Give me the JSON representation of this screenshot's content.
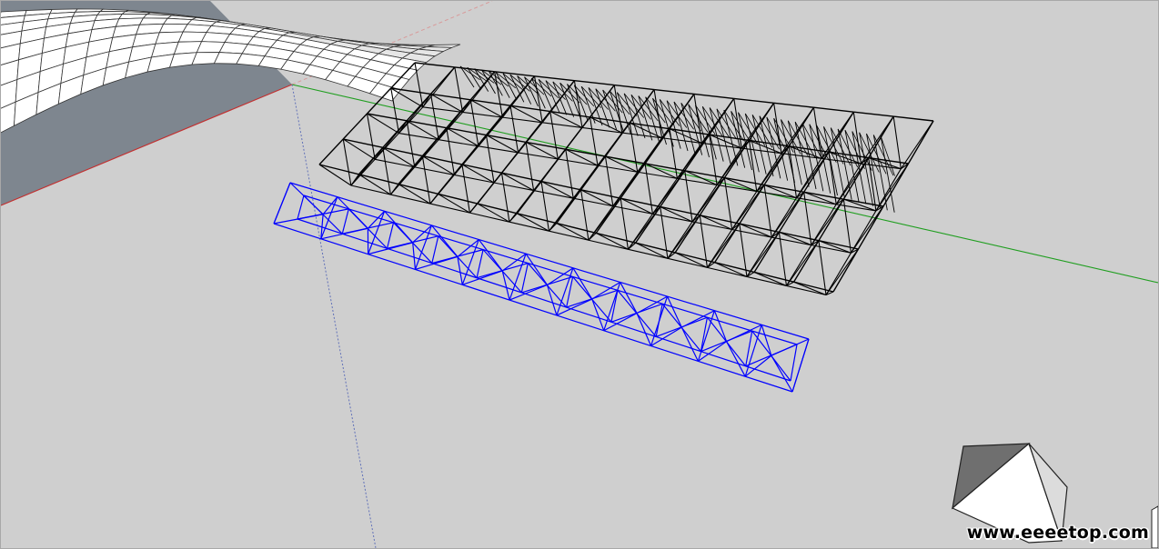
{
  "viewport": {
    "background_color": "#cfcfcf",
    "axis_colors": {
      "red": "#c23030",
      "green": "#1f9e1f",
      "blue": "#5060b0"
    },
    "selected_color": "#0000ff"
  },
  "scene": {
    "curved_surface": "wavy-surface-mesh",
    "black_truss": "space-frame-truss",
    "blue_truss": "selected-truss-strip",
    "solid_object": "white-pyramid-shape"
  },
  "watermark": {
    "text": "www.eeeetop.com"
  }
}
